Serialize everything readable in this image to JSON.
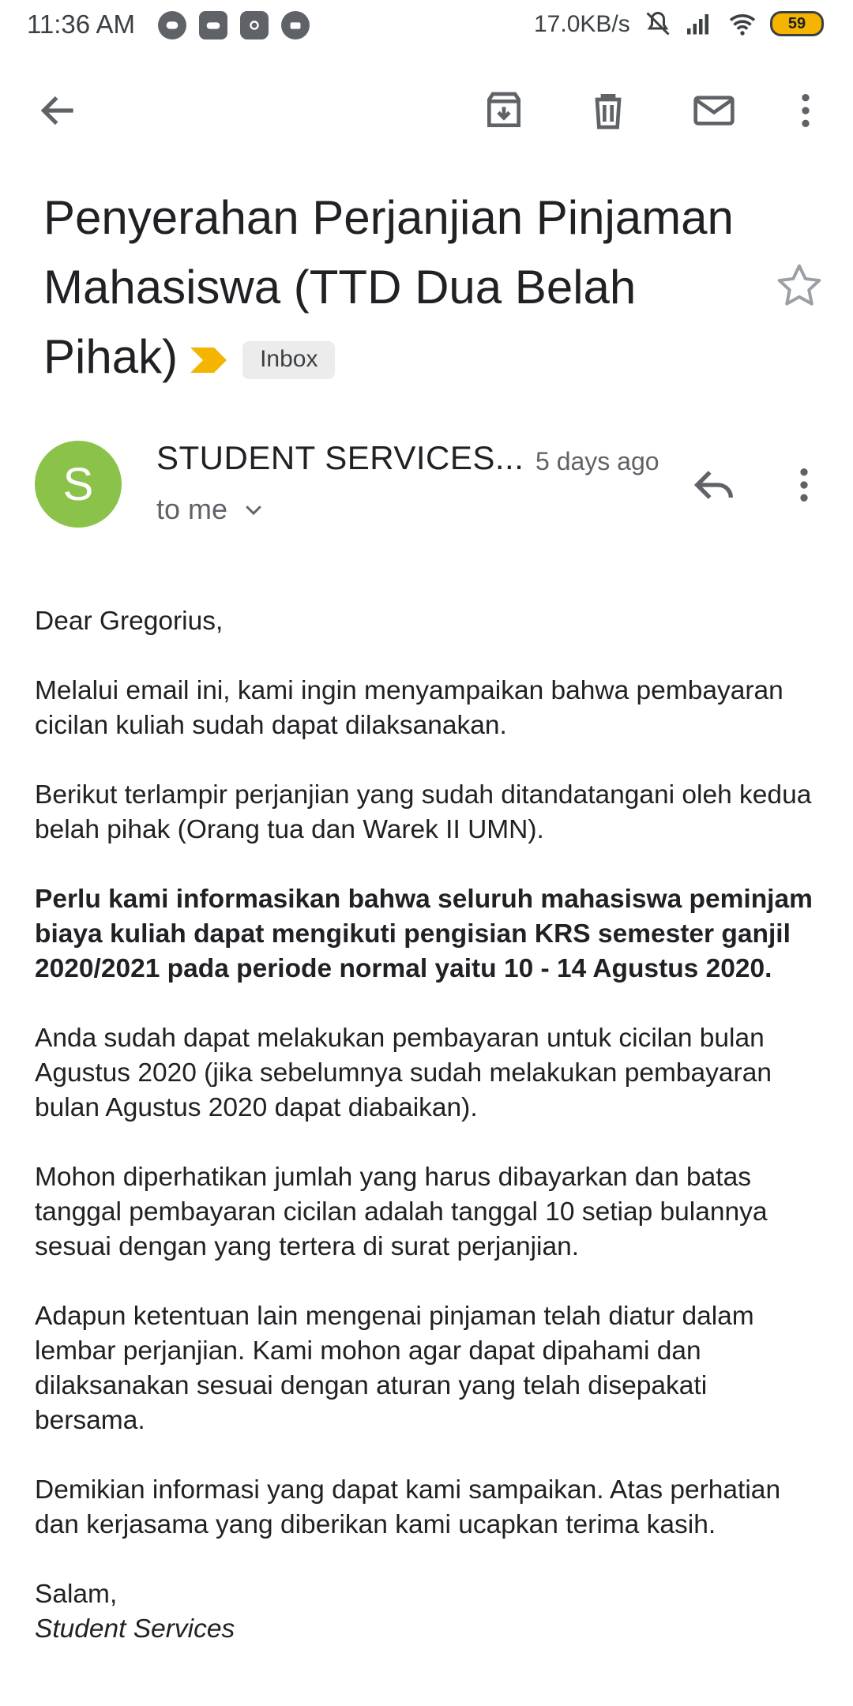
{
  "status_bar": {
    "time": "11:36 AM",
    "speed": "17.0KB/s",
    "battery": "59",
    "left_icons": [
      "line-icon",
      "game-icon",
      "instagram-icon",
      "chat-icon"
    ],
    "right_icons": [
      "mute-icon",
      "signal-icon",
      "wifi-icon",
      "battery-icon"
    ]
  },
  "toolbar": {
    "icons": [
      "back-arrow-icon",
      "archive-icon",
      "delete-icon",
      "mark-unread-icon",
      "more-vert-icon"
    ]
  },
  "email": {
    "subject": "Penyerahan Perjanjian Pinjaman Mahasiswa (TTD Dua Belah Pihak)",
    "label": "Inbox",
    "sender_initial": "S",
    "sender_name": "STUDENT SERVICES...",
    "time": "5 days ago",
    "recipient": "to me",
    "body": {
      "greeting": "Dear Gregorius,",
      "p1": "Melalui email ini, kami ingin menyampaikan bahwa pembayaran cicilan kuliah sudah dapat dilaksanakan.",
      "p2": "Berikut terlampir perjanjian yang sudah ditandatangani oleh kedua belah pihak (Orang tua dan Warek II UMN).",
      "p3_bold": "Perlu kami informasikan bahwa seluruh mahasiswa peminjam biaya kuliah dapat mengikuti pengisian KRS semester ganjil 2020/2021 pada periode normal yaitu 10 - 14 Agustus 2020.",
      "p4": "Anda sudah dapat melakukan pembayaran untuk cicilan bulan Agustus 2020 (jika sebelumnya sudah melakukan pembayaran bulan Agustus 2020 dapat diabaikan).",
      "p5": "Mohon diperhatikan jumlah yang harus dibayarkan dan batas tanggal pembayaran cicilan adalah tanggal 10 setiap bulannya sesuai dengan yang tertera di surat perjanjian.",
      "p6": "Adapun ketentuan lain mengenai pinjaman telah diatur dalam lembar perjanjian. Kami mohon agar dapat dipahami dan dilaksanakan sesuai dengan aturan yang telah disepakati bersama.",
      "p7": "Demikian informasi yang dapat kami sampaikan. Atas perhatian dan kerjasama yang diberikan kami ucapkan terima kasih.",
      "closing": "Salam,",
      "signature": "Student Services"
    }
  },
  "colors": {
    "avatar": "#8bc34a",
    "label_arrow": "#f4b400",
    "chip_bg": "#ececec"
  }
}
